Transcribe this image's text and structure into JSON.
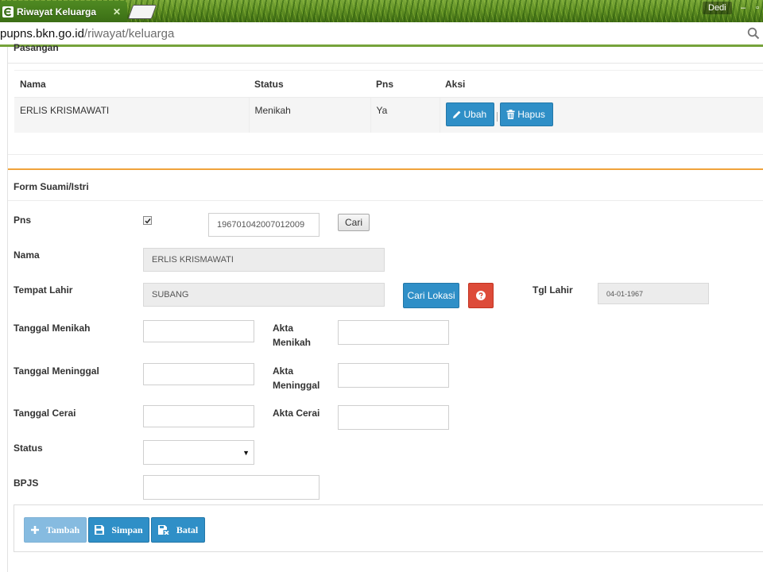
{
  "browser": {
    "tab_title": "Riwayat Keluarga",
    "profile_name": "Dedi",
    "url_host": "pupns.bkn.go.id",
    "url_path": "/riwayat/keluarga"
  },
  "pasangan": {
    "heading": "Pasangan",
    "columns": [
      "Nama",
      "Status",
      "Pns",
      "Aksi"
    ],
    "rows": [
      {
        "nama": "ERLIS KRISMAWATI",
        "status": "Menikah",
        "pns": "Ya",
        "ubah_label": "Ubah",
        "hapus_label": "Hapus"
      }
    ]
  },
  "form": {
    "title": "Form Suami/Istri",
    "pns": {
      "label": "Pns",
      "checked": true,
      "nip_value": "196701042007012009",
      "cari_label": "Cari"
    },
    "nama": {
      "label": "Nama",
      "value": "ERLIS KRISMAWATI"
    },
    "tempat_lahir": {
      "label": "Tempat Lahir",
      "value": "SUBANG",
      "cari_lokasi_label": "Cari Lokasi"
    },
    "tgl_lahir": {
      "label": "Tgl Lahir",
      "value": "04-01-1967"
    },
    "tanggal_menikah": {
      "label": "Tanggal Menikah",
      "value": ""
    },
    "akta_menikah": {
      "label_line1": "Akta",
      "label_line2": "Menikah",
      "value": ""
    },
    "tanggal_meninggal": {
      "label": "Tanggal Meninggal",
      "value": ""
    },
    "akta_meninggal": {
      "label_line1": "Akta",
      "label_line2": "Meninggal",
      "value": ""
    },
    "tanggal_cerai": {
      "label": "Tanggal Cerai",
      "value": ""
    },
    "akta_cerai": {
      "label": "Akta Cerai",
      "value": ""
    },
    "status": {
      "label": "Status",
      "selected": ""
    },
    "bpjs": {
      "label": "BPJS",
      "value": ""
    }
  },
  "actions": {
    "tambah_label": "Tambah",
    "simpan_label": "Simpan",
    "batal_label": "Batal"
  },
  "colors": {
    "primary": "#2f8fc7",
    "danger": "#dd4b39",
    "panel_accent": "#f0a33b",
    "chrome_green": "#5c8a22"
  },
  "icons": [
    "browser-favicon",
    "search-icon",
    "pencil-icon",
    "trash-icon",
    "question-icon",
    "plus-icon",
    "floppy-disk-icon",
    "floppy-remove-icon",
    "checkbox-check-icon"
  ]
}
